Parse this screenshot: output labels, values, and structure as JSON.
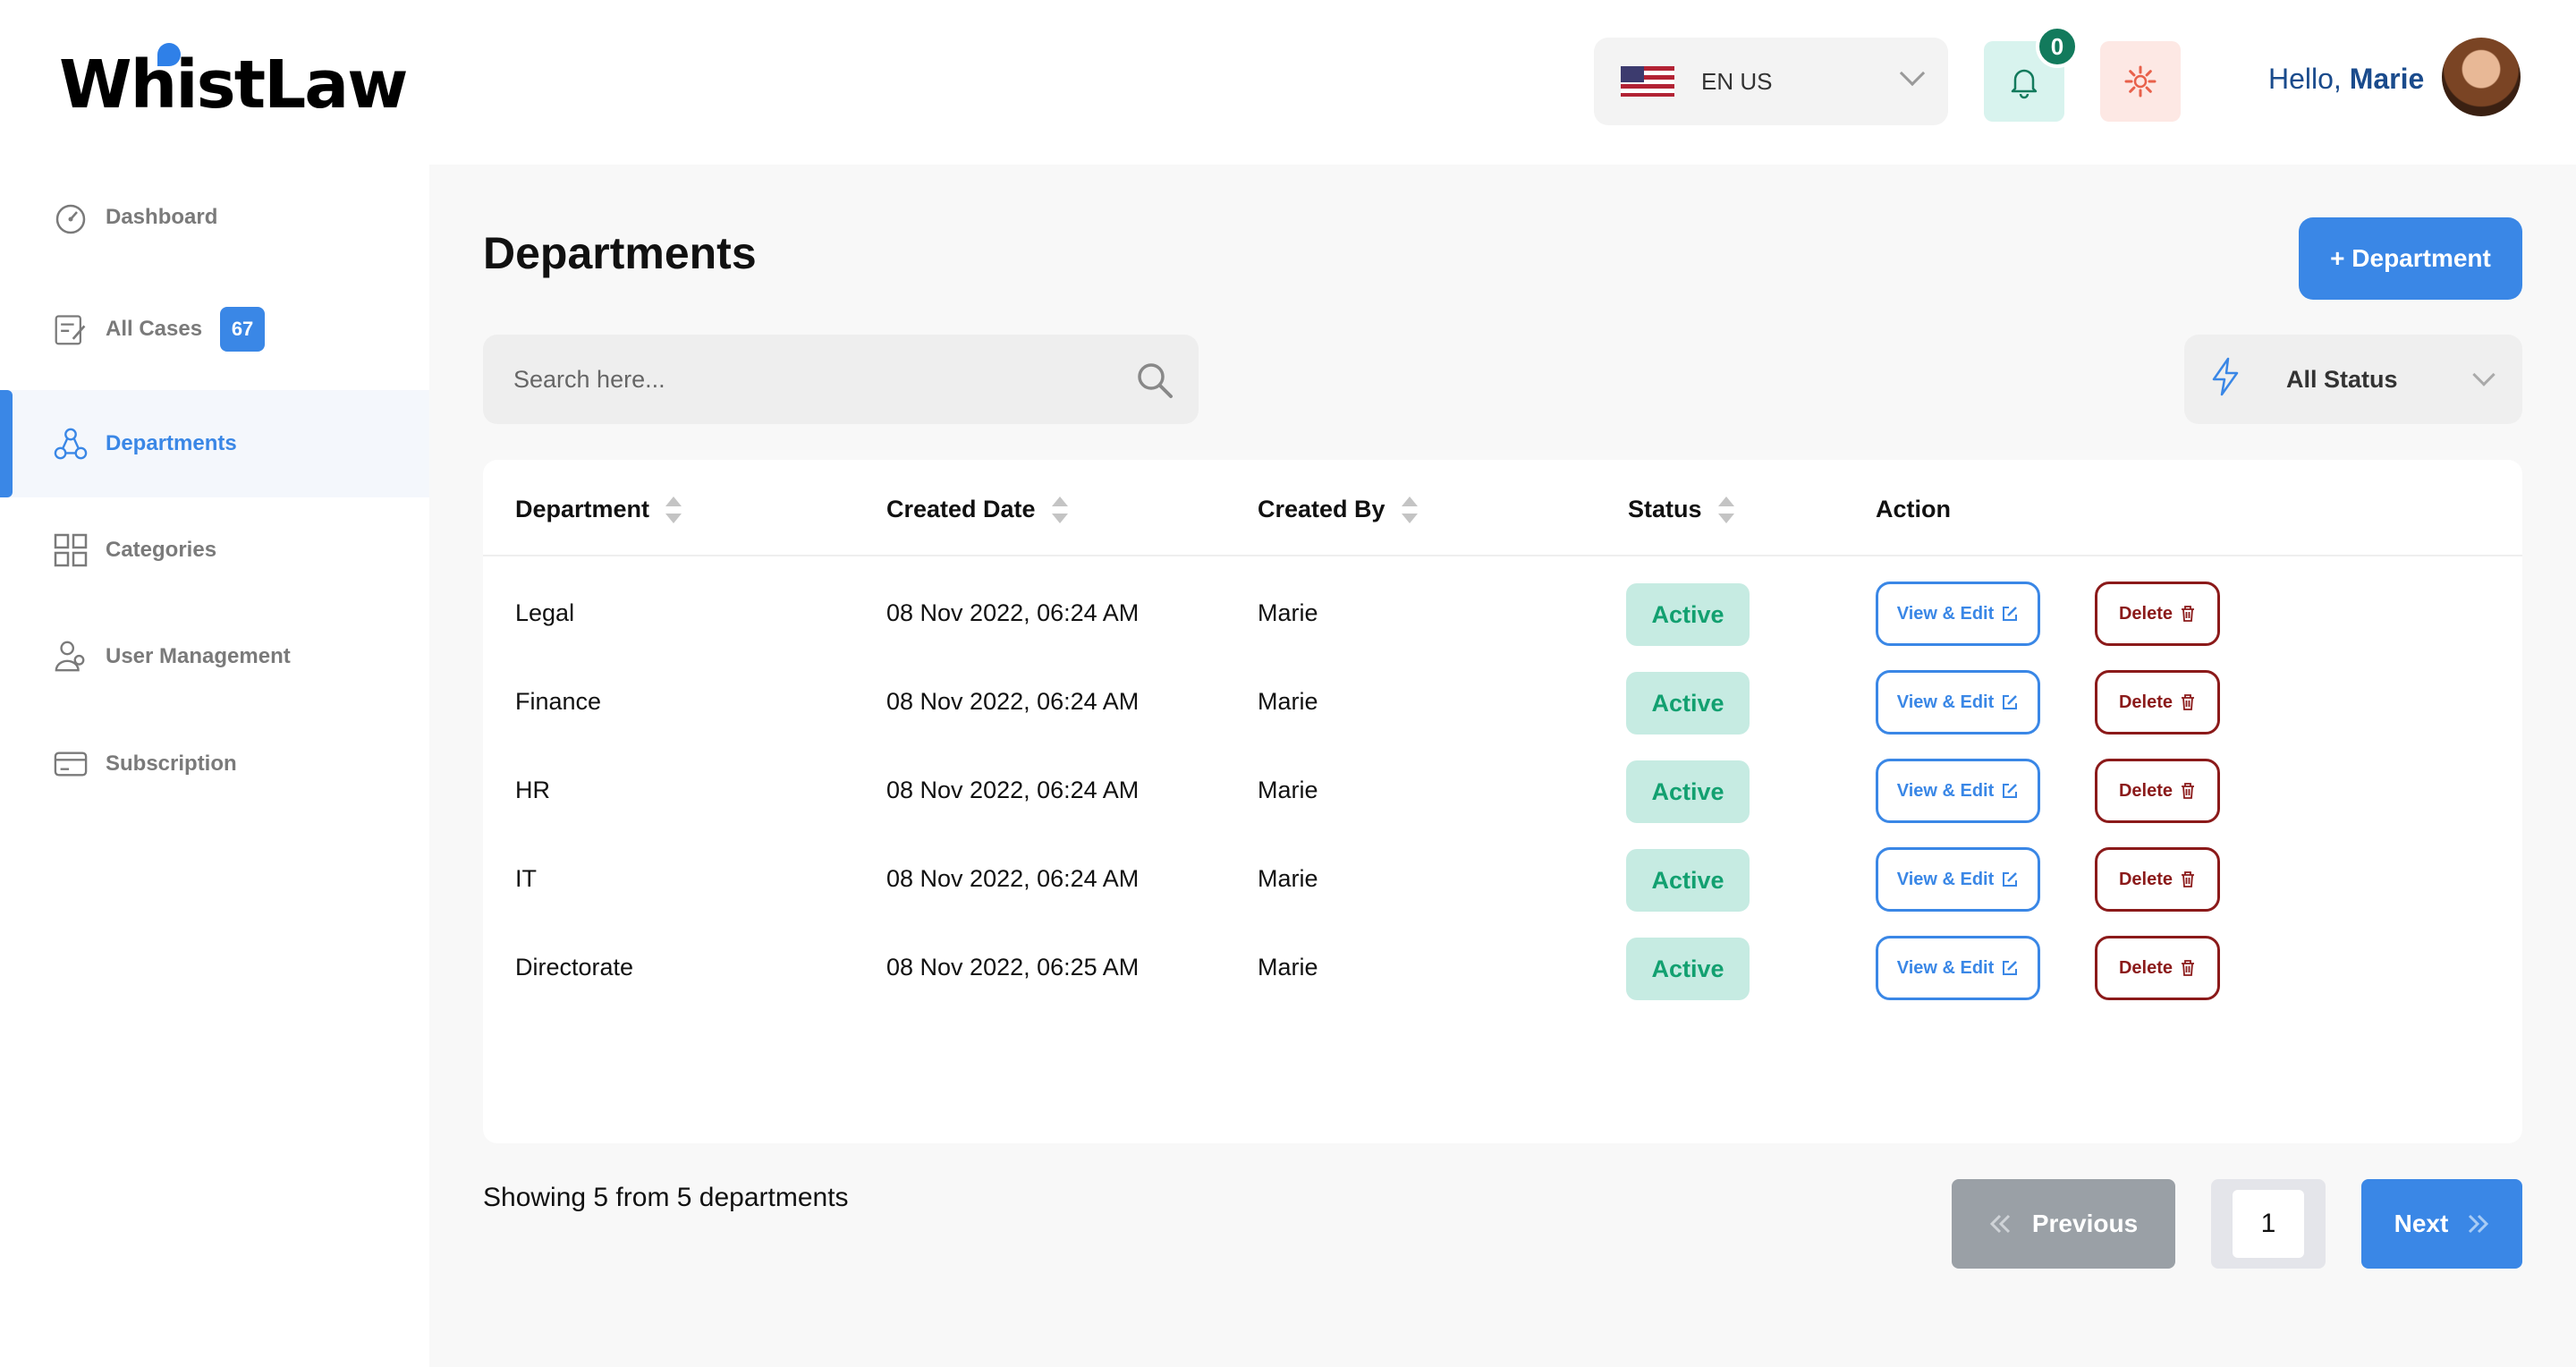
{
  "app": {
    "logo_text": "WhistLaw"
  },
  "sidebar": {
    "items": [
      {
        "label": "Dashboard",
        "icon": "dashboard-icon"
      },
      {
        "label": "All Cases",
        "icon": "cases-icon",
        "badge": "67"
      },
      {
        "label": "Departments",
        "icon": "departments-icon",
        "active": true
      },
      {
        "label": "Categories",
        "icon": "categories-icon"
      },
      {
        "label": "User Management",
        "icon": "user-management-icon"
      },
      {
        "label": "Subscription",
        "icon": "subscription-icon"
      }
    ]
  },
  "header": {
    "language": "EN US",
    "notifications_count": "0",
    "greeting": "Hello,",
    "user_name": "Marie"
  },
  "page": {
    "title": "Departments",
    "add_button": "+ Department",
    "search_placeholder": "Search here...",
    "status_filter": "All Status"
  },
  "table": {
    "columns": [
      "Department",
      "Created Date",
      "Created By",
      "Status",
      "Action"
    ],
    "rows": [
      {
        "department": "Legal",
        "created_date": "08 Nov 2022, 06:24 AM",
        "created_by": "Marie",
        "status": "Active"
      },
      {
        "department": "Finance",
        "created_date": "08 Nov 2022, 06:24 AM",
        "created_by": "Marie",
        "status": "Active"
      },
      {
        "department": "HR",
        "created_date": "08 Nov 2022, 06:24 AM",
        "created_by": "Marie",
        "status": "Active"
      },
      {
        "department": "IT",
        "created_date": "08 Nov 2022, 06:24 AM",
        "created_by": "Marie",
        "status": "Active"
      },
      {
        "department": "Directorate",
        "created_date": "08 Nov 2022, 06:25 AM",
        "created_by": "Marie",
        "status": "Active"
      }
    ],
    "view_edit_label": "View & Edit",
    "delete_label": "Delete"
  },
  "pagination": {
    "summary": "Showing 5 from 5 departments",
    "previous": "Previous",
    "current_page": "1",
    "next": "Next"
  },
  "colors": {
    "accent": "#3a87e6",
    "active_status_bg": "#c6ebe2",
    "active_status_text": "#12a070",
    "delete": "#8b1a1a"
  }
}
